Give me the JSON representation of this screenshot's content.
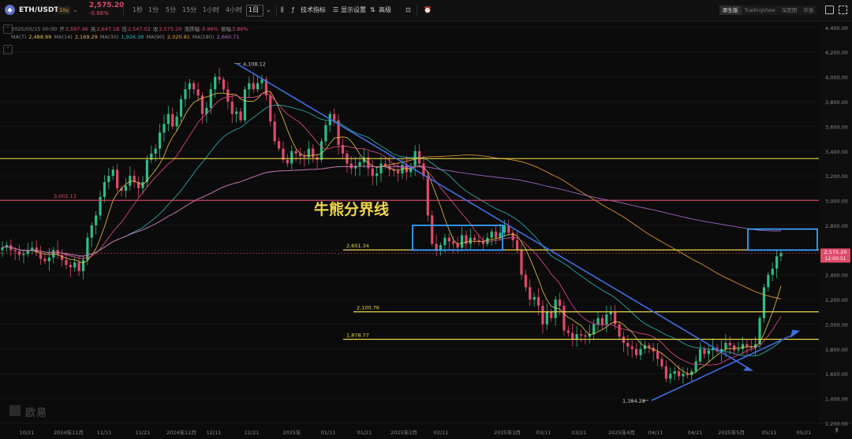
{
  "header": {
    "pair": "ETH/USDT",
    "leverage": "10x",
    "price": "2,575.20",
    "change": "-0.86%",
    "intervals": [
      "1秒",
      "1分",
      "5分",
      "15分",
      "1小时",
      "4小时",
      "1日"
    ],
    "active_interval": "1日",
    "tools": [
      "技术指标",
      "显示设置",
      "高级"
    ],
    "view_tabs": [
      "原生版",
      "TradingView",
      "深度图",
      "市值"
    ],
    "active_view": "原生版",
    "icons": [
      "eth-logo-icon",
      "chevron-down-icon",
      "candle-type-icon",
      "indicator-icon",
      "settings-icon",
      "advanced-icon",
      "camera-icon",
      "alert-icon",
      "window-icon",
      "fullscreen-icon"
    ]
  },
  "ohlc_legend": {
    "date": "2025/05/15 00:00",
    "open_label": "开",
    "open": "2,597.46",
    "high_label": "高",
    "high": "2,647.18",
    "low_label": "低",
    "low": "2,547.02",
    "close_label": "收",
    "close": "2,575.20",
    "change_label": "涨跌幅",
    "change": "-0.86%",
    "amp_label": "振幅",
    "amp": "3.86%"
  },
  "ma_legend": [
    {
      "name": "MA(7)",
      "value": "2,488.99",
      "color": "#e8c34a"
    },
    {
      "name": "MA(14)",
      "value": "2,169.29",
      "color": "#e8a96a"
    },
    {
      "name": "MA(30)",
      "value": "1,926.38",
      "color": "#2fb7b7"
    },
    {
      "name": "MA(90)",
      "value": "2,020.81",
      "color": "#f0a030"
    },
    {
      "name": "MA(180)",
      "value": "2,660.71",
      "color": "#b06ad0"
    }
  ],
  "annotation_text": "牛熊分界线",
  "watermark": "欧易",
  "colors": {
    "up": "#2ebd85",
    "down": "#e04a6a",
    "hline": "#e8d44a",
    "redline": "#e04a6a",
    "trend": "#3d6fe0",
    "box": "#3aa0ff"
  },
  "chart_data": {
    "type": "candlestick",
    "ylim": [
      1200,
      4450
    ],
    "y_ticks": [
      4400,
      4200,
      4000,
      3800,
      3600,
      3400,
      3200,
      3000,
      2800,
      2600,
      2400,
      2200,
      2000,
      1800,
      1600,
      1400,
      1200
    ],
    "y_tick_labels": [
      "4,400.00",
      "4,200.00",
      "4,000.00",
      "3,800.00",
      "3,600.00",
      "3,400.00",
      "3,200.00",
      "3,000.00",
      "2,800.00",
      "2,600.00",
      "2,400.00",
      "2,200.00",
      "2,000.00",
      "1,800.00",
      "1,600.00",
      "1,400.00",
      "1,200.00"
    ],
    "x_tick_labels": [
      "10/21",
      "2024年11月",
      "11/11",
      "11/21",
      "2024年12月",
      "12/11",
      "12/21",
      "2025年",
      "01/11",
      "01/21",
      "2025年2月",
      "02/11",
      "2025年3月",
      "03/11",
      "03/21",
      "2025年4月",
      "04/11",
      "04/21",
      "2025年5月",
      "05/11",
      "05/21"
    ],
    "current_price": {
      "value": 2575.2,
      "label": "2,575.20",
      "countdown": "12:00:51"
    },
    "horizontal_levels": [
      {
        "value": 3340,
        "label": "",
        "color": "#e8d44a"
      },
      {
        "value": 3002.13,
        "label": "3,002.13",
        "color": "#e04a6a"
      },
      {
        "value": 2601.34,
        "label": "2,601.34",
        "color": "#e8d44a"
      },
      {
        "value": 2100.76,
        "label": "2,100.76",
        "color": "#e8d44a"
      },
      {
        "value": 1878.77,
        "label": "1,878.77",
        "color": "#e8d44a"
      }
    ],
    "price_labels": [
      {
        "value": 4108.12,
        "label": "4,108.12"
      },
      {
        "value": 1384.28,
        "label": "1,384.28"
      }
    ],
    "closes": [
      2620,
      2640,
      2600,
      2590,
      2560,
      2570,
      2600,
      2620,
      2580,
      2530,
      2510,
      2540,
      2600,
      2560,
      2520,
      2480,
      2460,
      2500,
      2430,
      2520,
      2700,
      2800,
      2880,
      3030,
      3150,
      3200,
      3250,
      3100,
      3080,
      3120,
      3200,
      3150,
      3100,
      3150,
      3330,
      3380,
      3420,
      3550,
      3620,
      3700,
      3600,
      3680,
      3820,
      3900,
      3950,
      3900,
      3850,
      3700,
      3750,
      3900,
      4000,
      3980,
      3900,
      3800,
      3700,
      3720,
      3650,
      3900,
      3950,
      3900,
      3950,
      3980,
      3850,
      3640,
      3480,
      3420,
      3330,
      3300,
      3400,
      3380,
      3360,
      3350,
      3420,
      3350,
      3330,
      3480,
      3610,
      3700,
      3650,
      3450,
      3380,
      3300,
      3260,
      3280,
      3310,
      3350,
      3260,
      3200,
      3220,
      3300,
      3280,
      3250,
      3240,
      3220,
      3290,
      3230,
      3280,
      3400,
      3300,
      3200,
      2880,
      2650,
      2600,
      2640,
      2700,
      2670,
      2650,
      2620,
      2720,
      2650,
      2700,
      2680,
      2670,
      2650,
      2700,
      2750,
      2700,
      2740,
      2800,
      2740,
      2680,
      2600,
      2400,
      2300,
      2200,
      2220,
      2150,
      2000,
      2100,
      2050,
      2200,
      2150,
      1950,
      1930,
      1880,
      1920,
      1910,
      1900,
      1920,
      2000,
      2050,
      2000,
      2080,
      2100,
      2000,
      1900,
      1850,
      1820,
      1800,
      1750,
      1800,
      1830,
      1810,
      1780,
      1720,
      1660,
      1560,
      1600,
      1620,
      1580,
      1600,
      1590,
      1620,
      1700,
      1800,
      1760,
      1790,
      1810,
      1780,
      1800,
      1850,
      1830,
      1790,
      1800,
      1840,
      1820,
      1810,
      1840,
      2050,
      2300,
      2400,
      2450,
      2550,
      2575
    ]
  }
}
